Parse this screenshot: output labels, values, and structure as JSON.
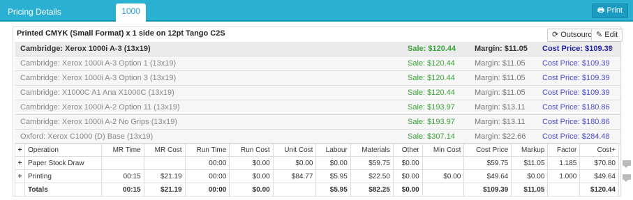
{
  "header": {
    "title": "Pricing Details",
    "active_tab": "1000",
    "print_icon": "printer-icon",
    "print_label": "Print"
  },
  "product": {
    "description": "Printed CMYK (Small Format) x 1 side on 12pt Tango C2S"
  },
  "buttons": {
    "outsource_icon": "outsource-icon",
    "outsource_label": "Outsource",
    "edit_icon": "edit-icon",
    "edit_label": "Edit"
  },
  "devices": [
    {
      "name": "Cambridge: Xerox 1000i A-3 (13x19)",
      "sale": "Sale: $120.44",
      "margin": "Margin: $11.05",
      "cost": "Cost Price: $109.39"
    },
    {
      "name": "Cambridge: Xerox 1000i A-3 Option 1 (13x19)",
      "sale": "Sale: $120.44",
      "margin": "Margin: $11.05",
      "cost": "Cost Price: $109.39"
    },
    {
      "name": "Cambridge: Xerox 1000i A-3 Option 3 (13x19)",
      "sale": "Sale: $120.44",
      "margin": "Margin: $11.05",
      "cost": "Cost Price: $109.39"
    },
    {
      "name": "Cambridge: X1000C A1 Ana X1000C (13x19)",
      "sale": "Sale: $120.44",
      "margin": "Margin: $11.05",
      "cost": "Cost Price: $109.39"
    },
    {
      "name": "Cambridge: Xerox 1000i A-2 Option 11 (13x19)",
      "sale": "Sale: $193.97",
      "margin": "Margin: $13.11",
      "cost": "Cost Price: $180.86"
    },
    {
      "name": "Cambridge: Xerox 1000i A-2 No Grips (13x19)",
      "sale": "Sale: $193.97",
      "margin": "Margin: $13.11",
      "cost": "Cost Price: $180.86"
    },
    {
      "name": "Oxford: Xerox C1000 (D) Base (13x19)",
      "sale": "Sale: $307.14",
      "margin": "Margin: $22.66",
      "cost": "Cost Price: $284.48"
    }
  ],
  "operations": {
    "columns": [
      "+",
      "Operation",
      "MR Time",
      "MR Cost",
      "Run Time",
      "Run Cost",
      "Unit Cost",
      "Labour",
      "Materials",
      "Other",
      "Min Cost",
      "Cost Price",
      "Markup",
      "Factor",
      "Cost+"
    ],
    "rows": [
      [
        "+",
        "Paper Stock Draw",
        "",
        "",
        "00:00",
        "$0.00",
        "$0.00",
        "$0.00",
        "$59.75",
        "$0.00",
        "",
        "$59.75",
        "$11.05",
        "1.185",
        "$70.80"
      ],
      [
        "+",
        "Printing",
        "00:15",
        "$21.19",
        "00:00",
        "$0.00",
        "$84.77",
        "$5.95",
        "$22.50",
        "$0.00",
        "$0.00",
        "$49.64",
        "$0.00",
        "1.000",
        "$49.64"
      ]
    ],
    "totals": [
      "",
      "Totals",
      "00:15",
      "$21.19",
      "00:00",
      "$0.00",
      "",
      "$5.95",
      "$82.25",
      "$0.00",
      "",
      "$109.39",
      "$11.05",
      "",
      "$120.44"
    ]
  },
  "colors": {
    "header_bg": "#2ab0d3",
    "sale_green": "#3aa33a",
    "cost_blue": "#4b4bcf"
  }
}
